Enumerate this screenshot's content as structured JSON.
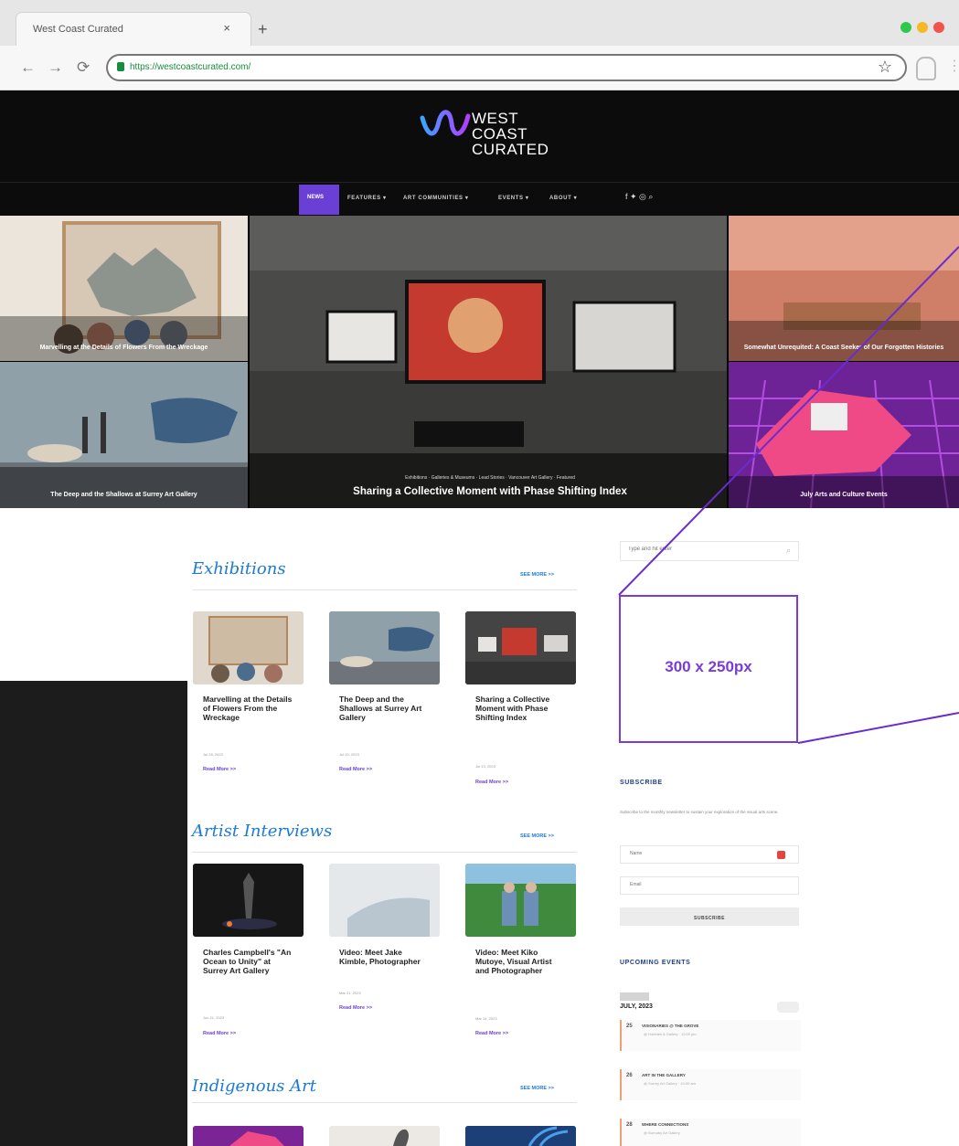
{
  "browser": {
    "tab_title": "West Coast Curated",
    "tab_close": "×",
    "new_tab": "+",
    "url": "https://westcoastcurated.com/",
    "back": "←",
    "forward": "→",
    "reload": "⟳",
    "bookmark": "☆",
    "menu": "⋮",
    "traffic_colors": [
      "#2ec84a",
      "#f5b926",
      "#f2544b"
    ]
  },
  "site": {
    "logo_lines": [
      "WEST",
      "COAST",
      "CURATED"
    ],
    "nav": {
      "active": "NEWS",
      "items": [
        "FEATURES ▾",
        "ART COMMUNITIES ▾",
        "EVENTS ▾",
        "ABOUT ▾"
      ],
      "social": "f ✦ ◎ ⌕"
    },
    "brand_purple": "#6a3fd6",
    "brand_blue": "#1d7ad2"
  },
  "hero": {
    "top_left": "Marvelling at the Details of Flowers From the Wreckage",
    "bottom_left": "The Deep and the Shallows at Surrey Art Gallery",
    "main_crumbs": "Exhibitions · Galleries & Museums · Lead Stories · Vancouver Art Gallery · Featured",
    "main_title": "Sharing a Collective Moment with Phase Shifting Index",
    "top_right": "Somewhat Unrequited: A Coast Seeker of Our Forgotten Histories",
    "bottom_right": "July Arts and Culture Events"
  },
  "sections": {
    "exhibitions": {
      "title": "Exhibitions",
      "see_more": "SEE MORE >>",
      "cards": [
        {
          "title": "Marvelling at the Details of Flowers From the Wreckage",
          "date": "Jul 28, 2023",
          "more": "Read More >>"
        },
        {
          "title": "The Deep and the Shallows at Surrey Art Gallery",
          "date": "Jul 20, 2023",
          "more": "Read More >>"
        },
        {
          "title": "Sharing a Collective Moment with Phase Shifting Index",
          "date": "Jul 13, 2023",
          "more": "Read More >>"
        }
      ]
    },
    "interviews": {
      "title": "Artist Interviews",
      "see_more": "SEE MORE >>",
      "cards": [
        {
          "title": "Charles Campbell's \"An Ocean to Unity\" at Surrey Art Gallery",
          "date": "Jun 21, 2023",
          "more": "Read More >>"
        },
        {
          "title": "Video: Meet Jake Kimble, Photographer",
          "date": "Mar 21, 2023",
          "more": "Read More >>"
        },
        {
          "title": "Video: Meet Kiko Mutoye, Visual Artist and Photographer",
          "date": "Mar 14, 2023",
          "more": "Read More >>"
        }
      ]
    },
    "indigenous": {
      "title": "Indigenous Art",
      "see_more": "SEE MORE >>"
    }
  },
  "sidebar": {
    "search_placeholder": "Type and hit enter",
    "ad_label": "300 x 250px",
    "subscribe_heading": "SUBSCRIBE",
    "subscribe_text": "Subscribe to the monthly newsletter to sustain your exploration of the visual arts scene.",
    "name_placeholder": "Name",
    "email_placeholder": "Email",
    "subscribe_button": "SUBSCRIBE",
    "events_heading": "UPCOMING EVENTS",
    "events_month": "JULY, 2023",
    "events": [
      {
        "day": "25",
        "title": "VISIONARIES @ THE GROVE",
        "sub": "@ Hobbies & Gallery  ·  12:00 pm"
      },
      {
        "day": "26",
        "title": "ART IN THE GALLERY",
        "sub": "@ Surrey Art Gallery  ·  10:00 am"
      },
      {
        "day": "28",
        "title": "WHERE CONNECTIONS",
        "sub": "@ Burnaby Art Gallery"
      }
    ]
  }
}
